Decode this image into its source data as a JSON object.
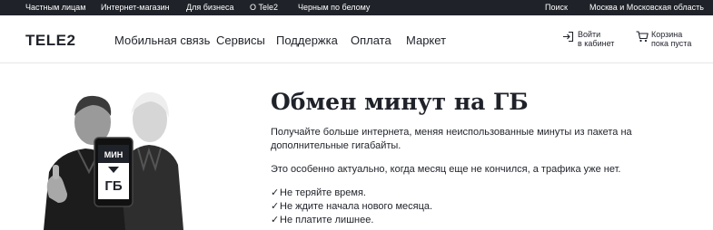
{
  "topbar": {
    "links": [
      "Частным лицам",
      "Интернет-магазин",
      "Для бизнеса",
      "О Tele2",
      "Черным по белому"
    ],
    "search": "Поиск",
    "region": "Москва и Московская область"
  },
  "header": {
    "logo": "TELE2",
    "nav": [
      "Мобильная связь",
      "Сервисы",
      "Поддержка",
      "Оплата",
      "Маркет"
    ],
    "login": [
      "Войти",
      "в кабинет"
    ],
    "cart": [
      "Корзина",
      "пока пуста"
    ]
  },
  "hero": {
    "phone_text": [
      "МИН",
      "ГБ"
    ],
    "title": "Обмен минут на ГБ",
    "paragraph1": "Получайте больше интернета, меняя неиспользованные минуты из пакета на дополнительные гигабайты.",
    "paragraph2": "Это особенно актуально, когда месяц еще не кончился, а трафика уже нет.",
    "check_mark": "✓",
    "checklist": [
      "Не теряйте время.",
      "Не ждите начала нового месяца.",
      "Не платите лишнее."
    ]
  },
  "colors": {
    "dark": "#1f2229",
    "white": "#ffffff",
    "divider": "#e6e6e6"
  },
  "icons": [
    "login-icon",
    "cart-icon",
    "arrow-down-icon"
  ]
}
